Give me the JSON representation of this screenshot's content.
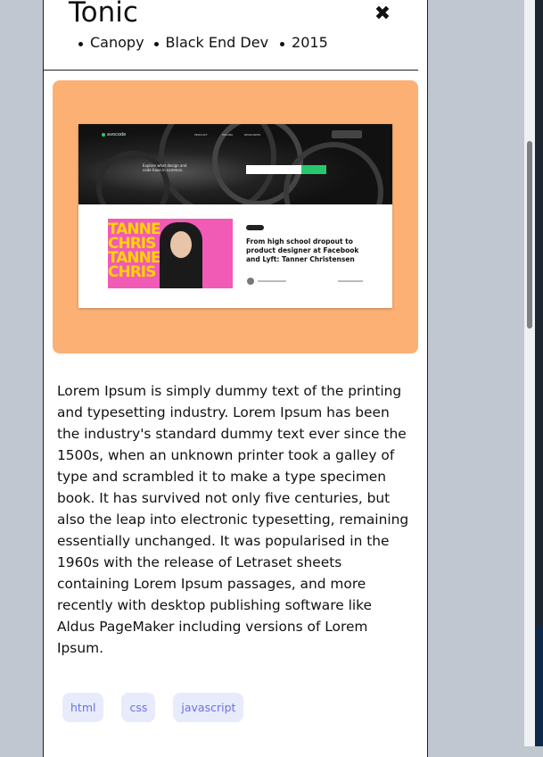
{
  "modal": {
    "title": "Tonic",
    "close_label": "✖",
    "meta": [
      "Canopy",
      "Black End Dev",
      "2015"
    ]
  },
  "hero": {
    "background": "#fdb074",
    "screenshot": {
      "logo": "avocode",
      "nav": [
        "PRODUCT",
        "PRICING",
        "RESOURCES"
      ],
      "tagline": "Explore what design and code have in common.",
      "article_title": "From high school dropout to product designer at Facebook and Lyft: Tanner Christensen",
      "image_text": [
        "TANNE",
        "CHRIS",
        "TANNE",
        "CHRIS"
      ]
    }
  },
  "description": "Lorem Ipsum is simply dummy text of the printing and typesetting industry. Lorem Ipsum has been the industry's standard dummy text ever since the 1500s, when an unknown printer took a galley of type and scrambled it to make a type specimen book. It has survived not only five centuries, but also the leap into electronic typesetting, remaining essentially unchanged. It was popularised in the 1960s with the release of Letraset sheets containing Lorem Ipsum passages, and more recently with desktop publishing software like Aldus PageMaker including versions of Lorem Ipsum.",
  "tags": [
    "html",
    "css",
    "javascript"
  ],
  "colors": {
    "tag_bg": "#e8ebfc",
    "tag_text": "#6b72e0",
    "page_bg": "#c1c7d0"
  }
}
